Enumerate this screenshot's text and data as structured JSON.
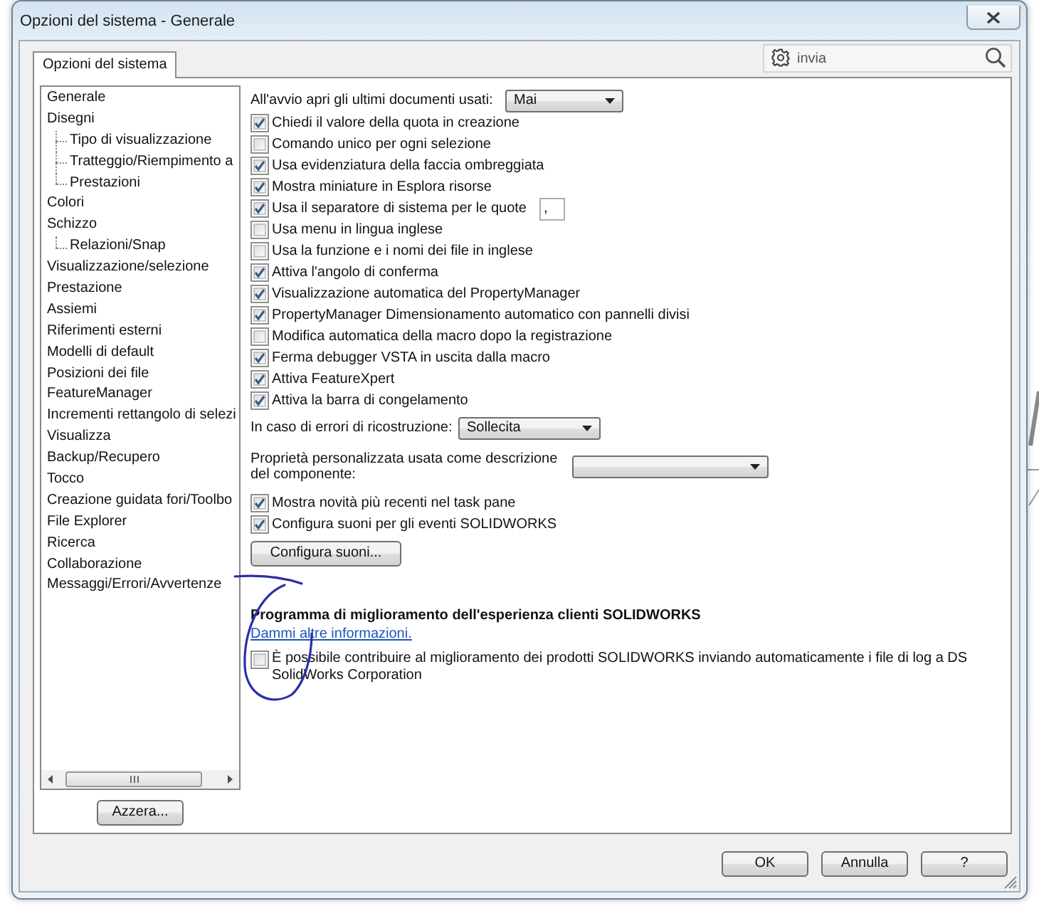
{
  "window": {
    "title": "Opzioni del sistema - Generale"
  },
  "tabs": [
    {
      "label": "Opzioni del sistema",
      "selected": true
    }
  ],
  "search": {
    "placeholder": "invia"
  },
  "tree": {
    "items": [
      {
        "label": "Generale"
      },
      {
        "label": "Disegni",
        "children": [
          {
            "label": "Tipo di visualizzazione"
          },
          {
            "label": "Tratteggio/Riempimento a"
          },
          {
            "label": "Prestazioni"
          }
        ]
      },
      {
        "label": "Colori"
      },
      {
        "label": "Schizzo",
        "children": [
          {
            "label": "Relazioni/Snap"
          }
        ]
      },
      {
        "label": "Visualizzazione/selezione"
      },
      {
        "label": "Prestazione"
      },
      {
        "label": "Assiemi"
      },
      {
        "label": "Riferimenti esterni"
      },
      {
        "label": "Modelli di default"
      },
      {
        "label": "Posizioni dei file"
      },
      {
        "label": "FeatureManager"
      },
      {
        "label": "Incrementi rettangolo di selezi"
      },
      {
        "label": "Visualizza"
      },
      {
        "label": "Backup/Recupero"
      },
      {
        "label": "Tocco"
      },
      {
        "label": "Creazione guidata fori/Toolbo"
      },
      {
        "label": "File Explorer"
      },
      {
        "label": "Ricerca"
      },
      {
        "label": "Collaborazione"
      },
      {
        "label": "Messaggi/Errori/Avvertenze"
      }
    ]
  },
  "reset_button": {
    "label": "Azzera..."
  },
  "settings": [
    {
      "kind": "dropdown",
      "label": "All'avvio apri gli ultimi documenti usati:",
      "value": "Mai"
    },
    {
      "kind": "checkbox",
      "label": "Chiedi il valore della quota in creazione",
      "checked": true
    },
    {
      "kind": "checkbox",
      "label": "Comando unico per ogni selezione",
      "checked": false
    },
    {
      "kind": "checkbox",
      "label": "Usa evidenziatura della faccia ombreggiata",
      "checked": true
    },
    {
      "kind": "checkbox",
      "label": "Mostra miniature in Esplora risorse",
      "checked": true
    },
    {
      "kind": "checkbox",
      "label": "Usa il separatore di sistema per le quote",
      "checked": true,
      "field_value": ","
    },
    {
      "kind": "checkbox",
      "label": "Usa menu in lingua inglese",
      "checked": false
    },
    {
      "kind": "checkbox",
      "label": "Usa la funzione e i nomi dei file in inglese",
      "checked": false
    },
    {
      "kind": "checkbox",
      "label": "Attiva l'angolo di conferma",
      "checked": true
    },
    {
      "kind": "checkbox",
      "label": "Visualizzazione automatica del PropertyManager",
      "checked": true
    },
    {
      "kind": "checkbox",
      "label": "PropertyManager Dimensionamento automatico con pannelli divisi",
      "checked": true
    },
    {
      "kind": "checkbox",
      "label": "Modifica automatica della macro dopo la registrazione",
      "checked": false
    },
    {
      "kind": "checkbox",
      "label": "Ferma debugger VSTA in uscita dalla macro",
      "checked": true
    },
    {
      "kind": "checkbox",
      "label": "Attiva FeatureXpert",
      "checked": true
    },
    {
      "kind": "checkbox",
      "label": "Attiva la barra di congelamento",
      "checked": true
    }
  ],
  "rebuild_errors": {
    "label": "In caso di errori di ricostruzione:",
    "value": "Sollecita"
  },
  "component_description": {
    "label": "Proprietà personalizzata usata come descrizione del componente:"
  },
  "settings_2": [
    {
      "kind": "checkbox",
      "label": "Mostra novità più recenti nel task pane",
      "checked": true
    },
    {
      "kind": "checkbox",
      "label": "Configura suoni per gli eventi SOLIDWORKS",
      "checked": true
    }
  ],
  "sounds_button": {
    "label": "Configura suoni..."
  },
  "improvement_program": {
    "title": "Programma di miglioramento dell'esperienza clienti SOLIDWORKS",
    "link": "Dammi altre informazioni.",
    "consent": {
      "label": "È possibile contribuire al miglioramento dei prodotti SOLIDWORKS inviando automaticamente i file di log a DS SolidWorks Corporation",
      "checked": false
    }
  },
  "buttons": [
    {
      "label": "OK"
    },
    {
      "label": "Annulla"
    },
    {
      "label": "?"
    }
  ]
}
